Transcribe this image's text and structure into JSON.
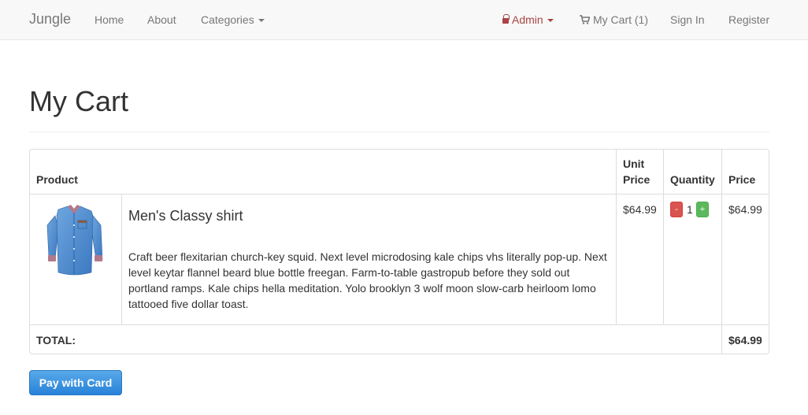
{
  "navbar": {
    "brand": "Jungle",
    "home": "Home",
    "about": "About",
    "categories": "Categories",
    "admin": "Admin",
    "cart": "My Cart (1)",
    "sign_in": "Sign In",
    "register": "Register"
  },
  "page": {
    "title": "My Cart"
  },
  "table": {
    "headers": {
      "product": "Product",
      "unit_price_line1": "Unit",
      "unit_price_line2": "Price",
      "quantity": "Quantity",
      "price": "Price"
    },
    "items": [
      {
        "name": "Men's Classy shirt",
        "description": "Craft beer flexitarian church-key squid. Next level microdosing kale chips vhs literally pop-up. Next level keytar flannel beard blue bottle freegan. Farm-to-table gastropub before they sold out portland ramps. Kale chips hella meditation. Yolo brooklyn 3 wolf moon slow-carb heirloom lomo tattooed five dollar toast.",
        "unit_price": "$64.99",
        "quantity": "1",
        "minus_label": "-",
        "plus_label": "+",
        "price": "$64.99"
      }
    ],
    "total_label": "TOTAL:",
    "total_value": "$64.99"
  },
  "actions": {
    "pay_label": "Pay with Card"
  },
  "colors": {
    "admin_red": "#a94442",
    "minus_red": "#d9534f",
    "plus_green": "#5cb85c",
    "pay_blue": "#2882d8"
  }
}
